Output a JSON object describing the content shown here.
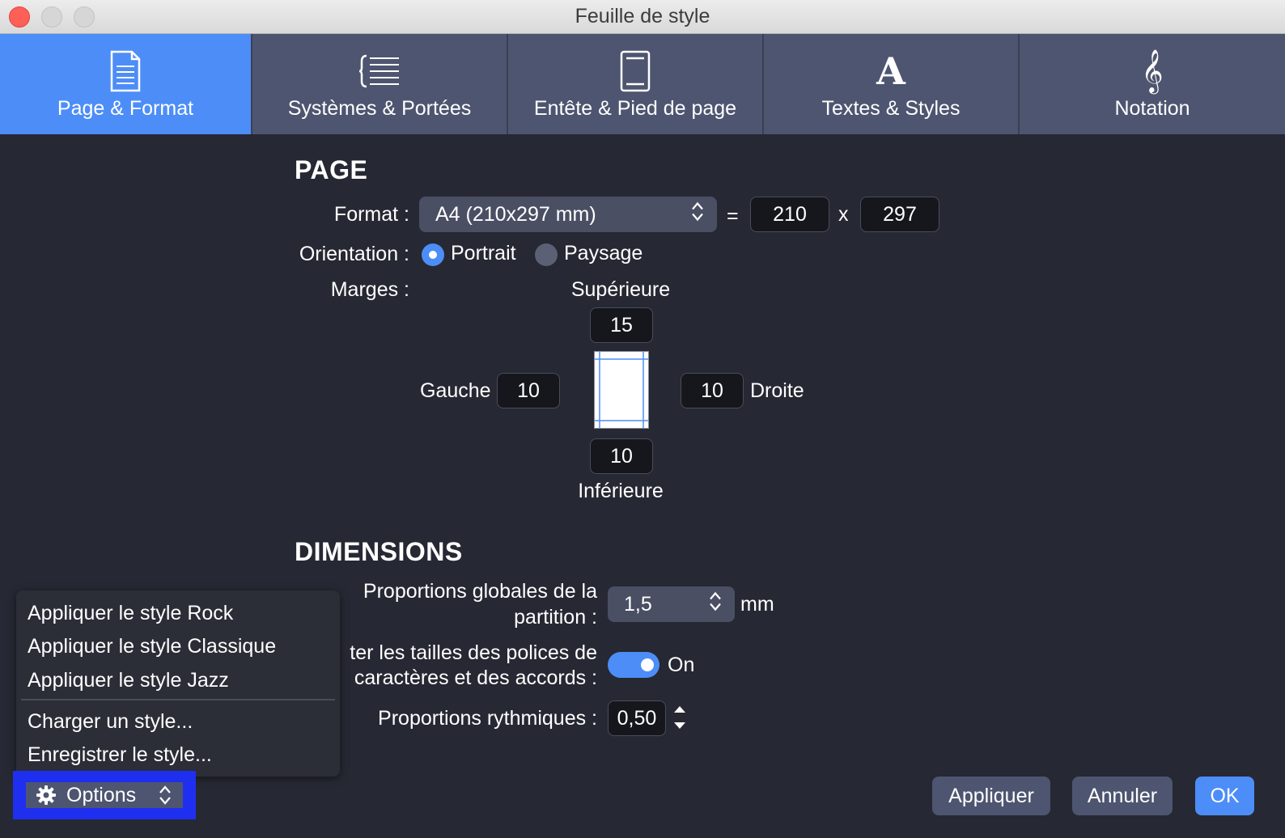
{
  "window": {
    "title": "Feuille de style"
  },
  "tabs": [
    {
      "label": "Page & Format",
      "icon": "page-icon",
      "active": true
    },
    {
      "label": "Systèmes & Portées",
      "icon": "staff-systems-icon",
      "active": false
    },
    {
      "label": "Entête & Pied de page",
      "icon": "header-footer-icon",
      "active": false
    },
    {
      "label": "Textes & Styles",
      "icon": "text-style-icon",
      "active": false
    },
    {
      "label": "Notation",
      "icon": "treble-clef-icon",
      "active": false
    }
  ],
  "page": {
    "title": "PAGE",
    "format_label": "Format :",
    "format_value": "A4 (210x297 mm)",
    "equals": "=",
    "width": "210",
    "times": "x",
    "height": "297",
    "orientation_label": "Orientation :",
    "portrait_label": "Portrait",
    "landscape_label": "Paysage",
    "orientation_selected": "Portrait",
    "margins_label": "Marges :",
    "top_label": "Supérieure",
    "top_value": "15",
    "left_label": "Gauche",
    "left_value": "10",
    "right_label": "Droite",
    "right_value": "10",
    "bottom_label": "Inférieure",
    "bottom_value": "10"
  },
  "dimensions": {
    "title": "DIMENSIONS",
    "global_label_line1": "Proportions globales de la",
    "global_label_line2": "partition :",
    "global_value": "1,5",
    "global_unit": "mm",
    "fonts_label_line1": "ter les tailles des polices de",
    "fonts_label_line2": "caractères et des accords :",
    "fonts_toggle": "On",
    "rhythm_label": "Proportions rythmiques :",
    "rhythm_value": "0,50"
  },
  "options_menu": {
    "items_group1": [
      "Appliquer le style Rock",
      "Appliquer le style Classique",
      "Appliquer le style Jazz"
    ],
    "items_group2": [
      "Charger un style...",
      "Enregistrer le style..."
    ],
    "button_label": "Options"
  },
  "footer": {
    "apply_label": "Appliquer",
    "cancel_label": "Annuler",
    "ok_label": "OK"
  },
  "colors": {
    "accent": "#4d8df7",
    "background": "#262833",
    "tab_bg": "#4e5570",
    "highlight_outline": "#1f2ff0"
  }
}
